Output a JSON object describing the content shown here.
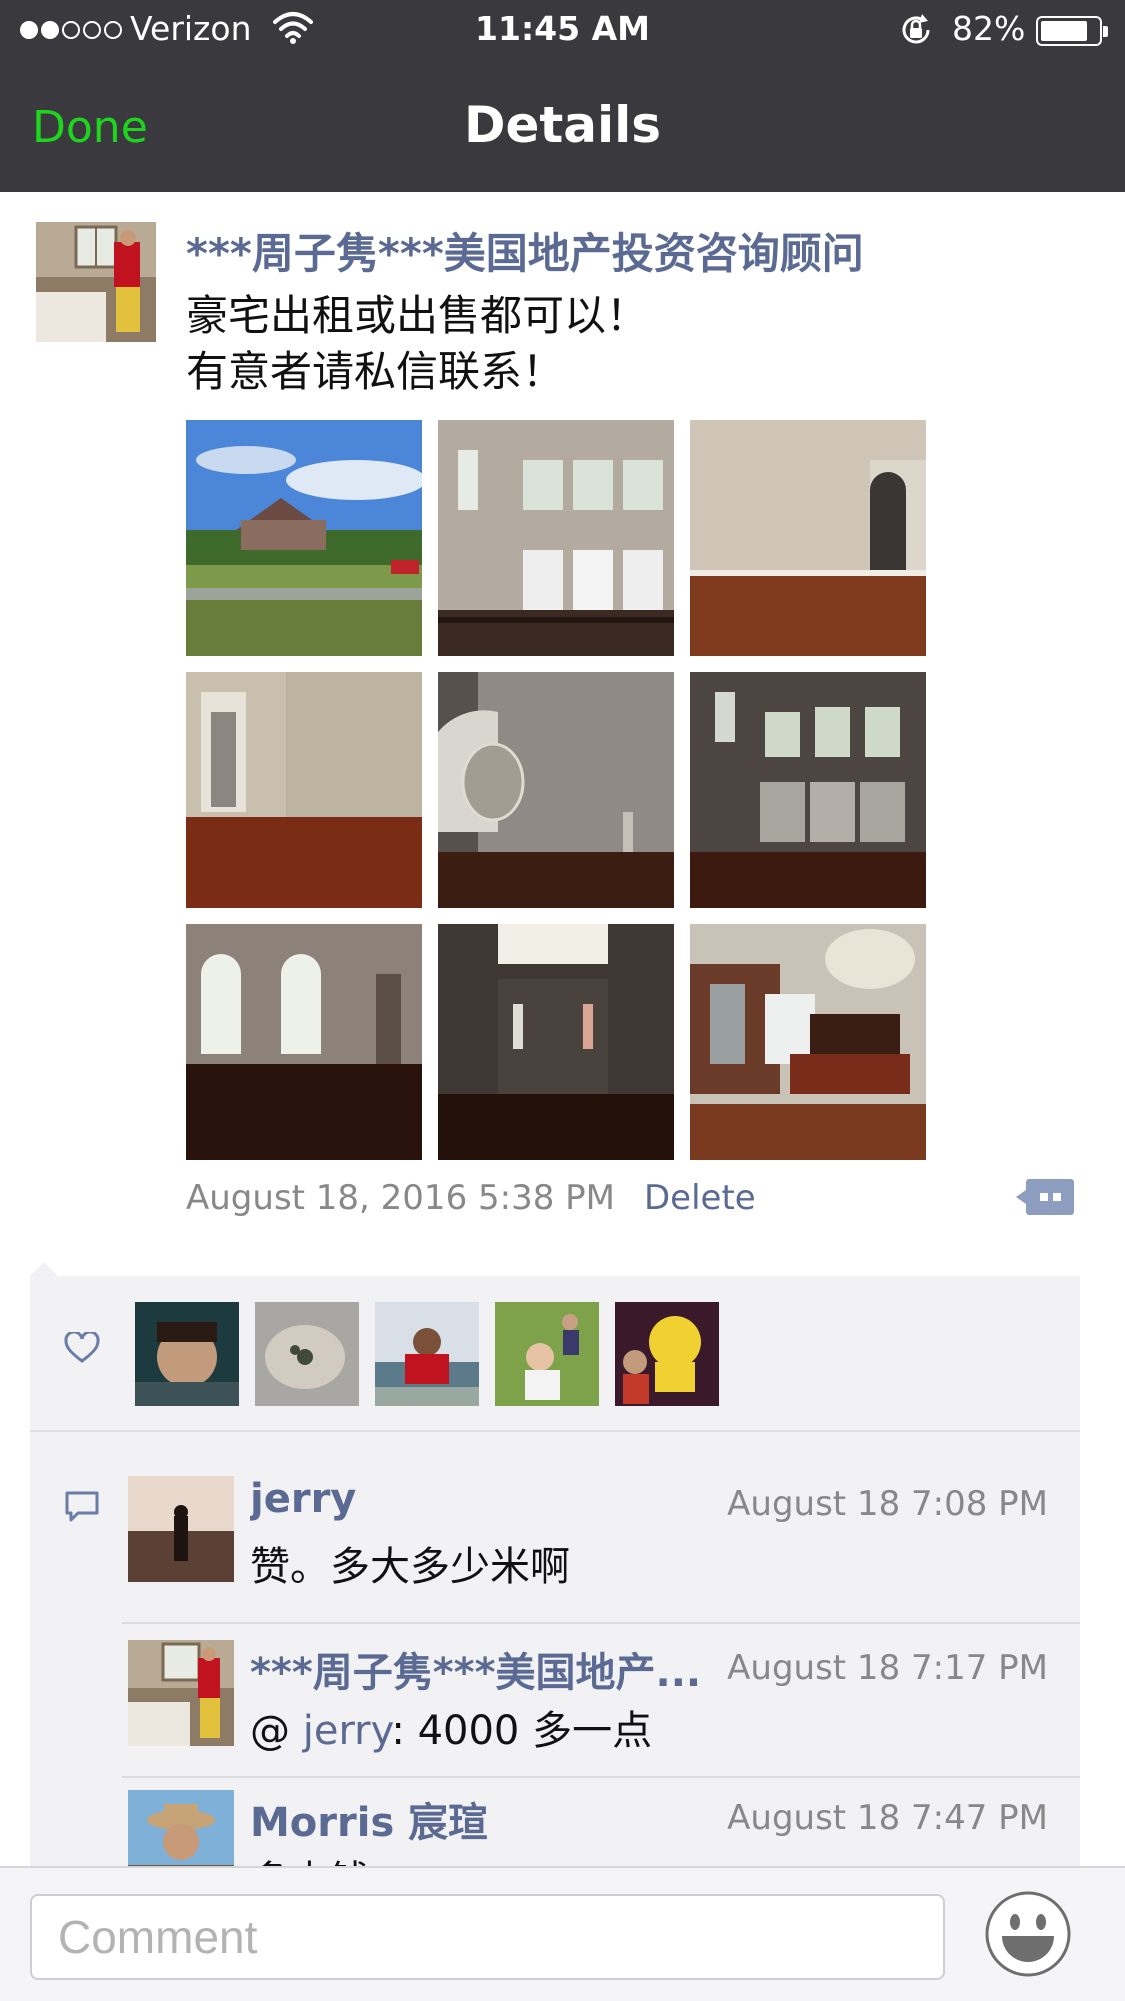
{
  "status_bar": {
    "carrier": "Verizon",
    "time": "11:45 AM",
    "battery": "82%",
    "battery_level": 0.82,
    "signal_bars": 2,
    "icons": [
      "signal-dots-icon",
      "wifi-icon",
      "rotation-lock-icon",
      "battery-icon"
    ]
  },
  "nav": {
    "done_label": "Done",
    "title": "Details"
  },
  "post": {
    "author": "***周子隽***美国地产投资咨询顾问",
    "text_line1": "豪宅出租或出售都可以！",
    "text_line2": "有意者请私信联系！",
    "timestamp": "August 18, 2016 5:38 PM",
    "delete_label": "Delete",
    "photo_count": 9
  },
  "likes": {
    "icon": "heart-icon",
    "count": 5
  },
  "comments": [
    {
      "name": "jerry",
      "time": "August 18 7:08 PM",
      "text": "赞。多大多少米啊"
    },
    {
      "name": "***周子隽***美国地产...",
      "time": "August 18 7:17 PM",
      "mention": "jerry",
      "text_prefix": "@ ",
      "text": ": 4000 多一点"
    },
    {
      "name": "Morris 宸瑄",
      "time": "August 18 7:47 PM",
      "text": "多少钱"
    }
  ],
  "input": {
    "placeholder": "Comment",
    "emoji_icon": "emoji-smile-icon"
  },
  "colors": {
    "nav_bg": "#3a393e",
    "done_green": "#1ed51e",
    "link_blue": "#5b6a92",
    "panel_bg": "#f2f2f4"
  }
}
